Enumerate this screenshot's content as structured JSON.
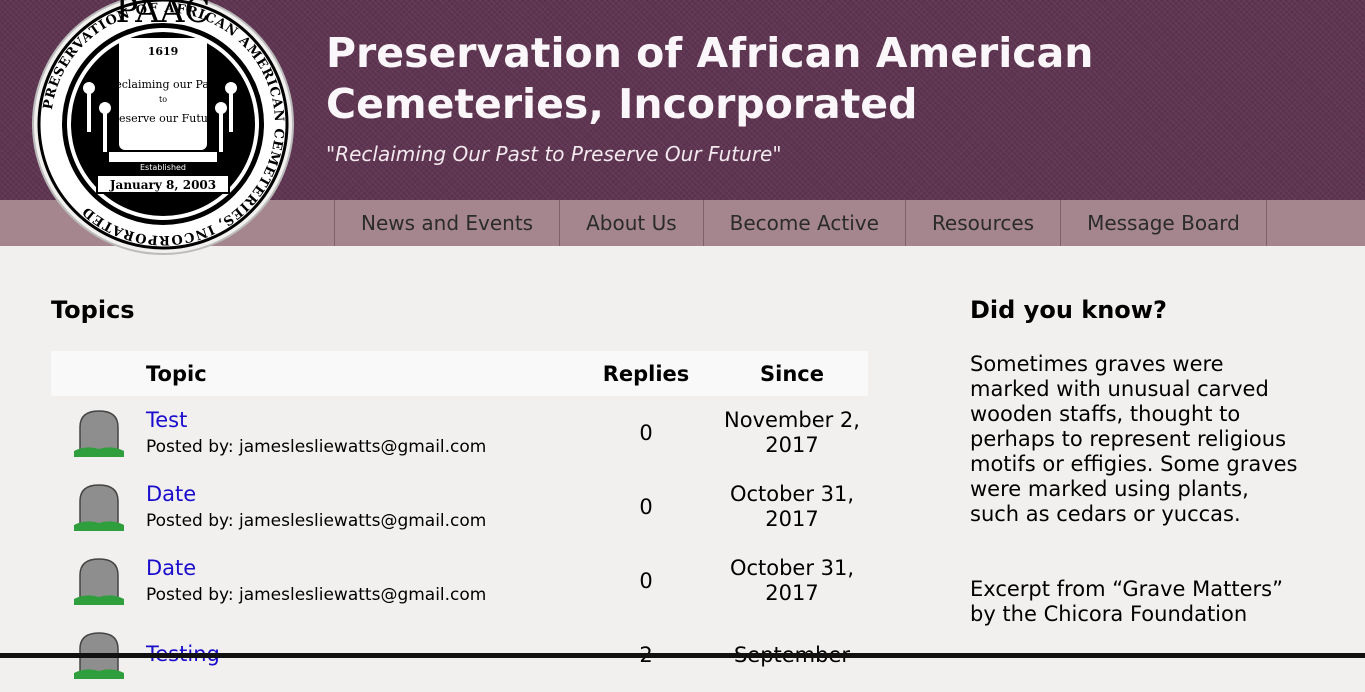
{
  "header": {
    "logo": {
      "arc_top": "PAAC",
      "year": "1619",
      "motto_line1": "Reclaiming our Past",
      "motto_line2": "to",
      "motto_line3": "Preserve our Future",
      "established": "Established",
      "date": "January 8, 2003",
      "ring_left": "PRESERVATION OF AFRICAN AMERICAN CEMETERIES, INCORPORATED"
    },
    "title_line1": "Preservation of African American",
    "title_line2": "Cemeteries, Incorporated",
    "tagline": "\"Reclaiming Our Past to Preserve Our Future\""
  },
  "nav": {
    "items": [
      {
        "label": "News and Events"
      },
      {
        "label": "About Us"
      },
      {
        "label": "Become Active"
      },
      {
        "label": "Resources"
      },
      {
        "label": "Message Board"
      }
    ]
  },
  "topics": {
    "heading": "Topics",
    "columns": {
      "topic": "Topic",
      "replies": "Replies",
      "since": "Since"
    },
    "rows": [
      {
        "title": "Test",
        "posted_by": "Posted by: jameslesliewatts@gmail.com",
        "replies": "0",
        "since_line1": "November 2,",
        "since_line2": "2017"
      },
      {
        "title": "Date",
        "posted_by": "Posted by: jameslesliewatts@gmail.com",
        "replies": "0",
        "since_line1": "October 31,",
        "since_line2": "2017"
      },
      {
        "title": "Date",
        "posted_by": "Posted by: jameslesliewatts@gmail.com",
        "replies": "0",
        "since_line1": "October 31,",
        "since_line2": "2017"
      },
      {
        "title": "Testing",
        "posted_by": "",
        "replies": "2",
        "since_line1": "September",
        "since_line2": ""
      }
    ]
  },
  "sidebar": {
    "heading": "Did you know?",
    "text": "Sometimes graves were marked with unusual carved wooden staffs, thought to perhaps to represent religious motifs or effigies. Some graves were marked using plants, such as cedars or yuccas.",
    "credit": "Excerpt from “Grave Matters” by the Chicora Foundation"
  },
  "colors": {
    "header_bg": "#5f3552",
    "nav_bg": "#a5868f",
    "page_bg": "#f2f0ee",
    "link": "#1a0dcc"
  }
}
